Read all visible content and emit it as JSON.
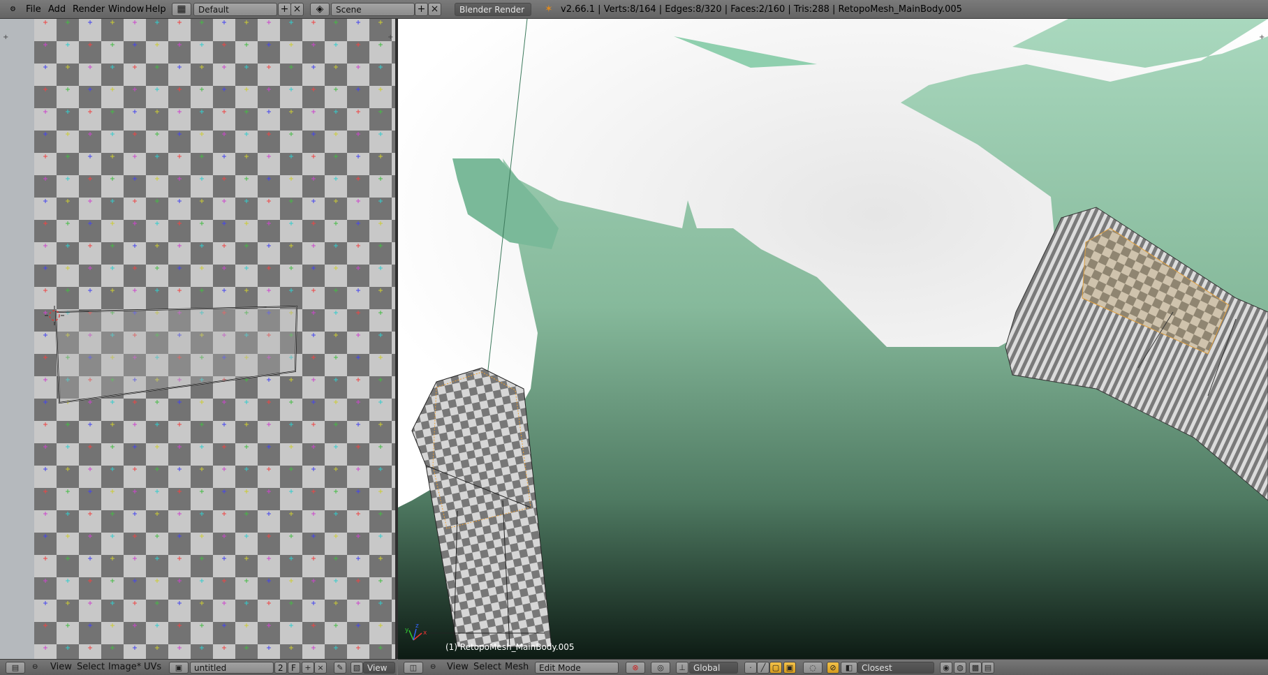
{
  "topbar": {
    "menu": [
      "File",
      "Add",
      "Render",
      "Window",
      "Help"
    ],
    "screen_layout": "Default",
    "scene": "Scene",
    "render_engine": "Blender Render",
    "status": "v2.66.1 | Verts:8/164 | Edges:8/320 | Faces:2/160 | Tris:288 | RetopoMesh_MainBody.005"
  },
  "uv_editor": {
    "header_menu": [
      "View",
      "Select",
      "Image*",
      "UVs"
    ],
    "image_name": "untitled",
    "image_users": "2",
    "fake_user": "F",
    "view_label": "View"
  },
  "viewport": {
    "object_label": "(1) RetopoMesh_MainBody.005",
    "header_menu": [
      "View",
      "Select",
      "Mesh"
    ],
    "mode": "Edit Mode",
    "orientation": "Global",
    "snap_target": "Closest",
    "axis_labels": {
      "x": "x",
      "y": "y",
      "z": "z"
    }
  },
  "colors": {
    "header": "#727272",
    "sky_top": "#a9d8be",
    "ground_dark": "#0d1b14",
    "selection": "#f3a33a"
  }
}
